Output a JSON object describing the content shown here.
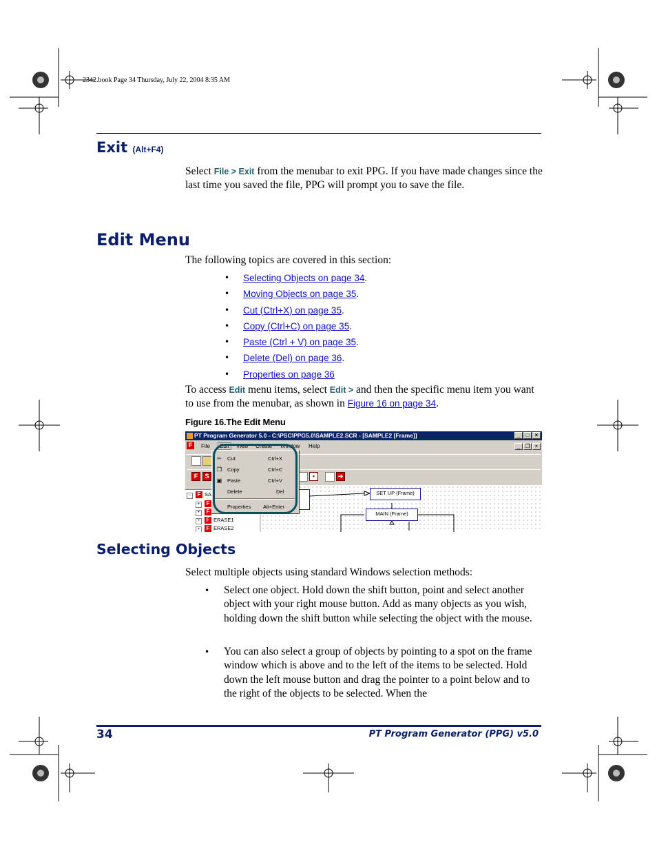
{
  "header_stamp": "2342.book  Page 34  Thursday, July 22, 2004  8:35 AM",
  "exit_section": {
    "heading": "Exit",
    "shortcut": "(Alt+F4)",
    "para_prefix": "Select ",
    "menu_file": "File",
    "menu_sep": " > ",
    "menu_exit": "Exit",
    "para_rest": " from the menubar to exit PPG. If you have made changes since the last time you saved the file, PPG will prompt you to save the file."
  },
  "edit_menu": {
    "heading": "Edit Menu",
    "intro": "The following topics are covered in this section:",
    "topics": [
      {
        "link": "Selecting Objects on page 34",
        "suffix": "."
      },
      {
        "link": "Moving Objects on page 35",
        "suffix": "."
      },
      {
        "link": "Cut (Ctrl+X) on page 35",
        "suffix": "."
      },
      {
        "link": "Copy (Ctrl+C) on page 35",
        "suffix": "."
      },
      {
        "link": "Paste (Ctrl + V) on page 35",
        "suffix": "."
      },
      {
        "link": "Delete (Del) on page 36",
        "suffix": "."
      },
      {
        "link": "Properties on page 36",
        "suffix": ""
      }
    ],
    "bullet_glyph": "•",
    "access_p1": "To access ",
    "access_edit1": "Edit",
    "access_p2": " menu items, select ",
    "access_edit2": "Edit >",
    "access_p3": " and then the specific menu item you want to use from the menubar, as shown in ",
    "access_link": "Figure 16 on page 34",
    "access_p4": ".",
    "figure_caption": "Figure 16.The Edit Menu"
  },
  "screenshot": {
    "title": "PT Program Generator 5.0 - C:\\PSC\\PPG5.0\\SAMPLE2.SCR - [SAMPLE2 [Frame]]",
    "menus": [
      "File",
      "Edit",
      "View",
      "Create",
      "Window",
      "Help"
    ],
    "dropdown": [
      {
        "label": "Cut",
        "accel": "Ctrl+X",
        "icon": "scissors-icon"
      },
      {
        "label": "Copy",
        "accel": "Ctrl+C",
        "icon": "copy-icon"
      },
      {
        "label": "Paste",
        "accel": "Ctrl+V",
        "icon": "paste-icon"
      },
      {
        "label": "Delete",
        "accel": "Del",
        "icon": ""
      },
      {
        "label": "Properties",
        "accel": "Alt+Enter",
        "icon": ""
      }
    ],
    "tree_items": [
      "SA",
      "",
      "",
      "ERASE1",
      "ERASE2"
    ],
    "frames": [
      "SET UP (Frame)",
      "MAIN (Frame)"
    ],
    "frame_color": "#1a1aa0",
    "callout_color": "#0c5060"
  },
  "selecting": {
    "heading": "Selecting Objects",
    "intro": "Select multiple objects using standard Windows selection methods:",
    "bullets": [
      "Select one object. Hold down the shift button, point and select another object with your right mouse button. Add as many objects as you wish, holding down the shift button while selecting the object with the mouse.",
      "You can also select a group of objects by pointing to a spot on the frame window which is above and to the left of the items to be selected. Hold down the left mouse button and drag the pointer to a point below and to the right of the objects to be selected. When the"
    ]
  },
  "footer": {
    "page_number": "34",
    "title": "PT Program Generator (PPG)  v5.0"
  },
  "colors": {
    "heading": "#0a1e6e",
    "link": "#1010cc",
    "ui_text": "#1f5f6e"
  }
}
